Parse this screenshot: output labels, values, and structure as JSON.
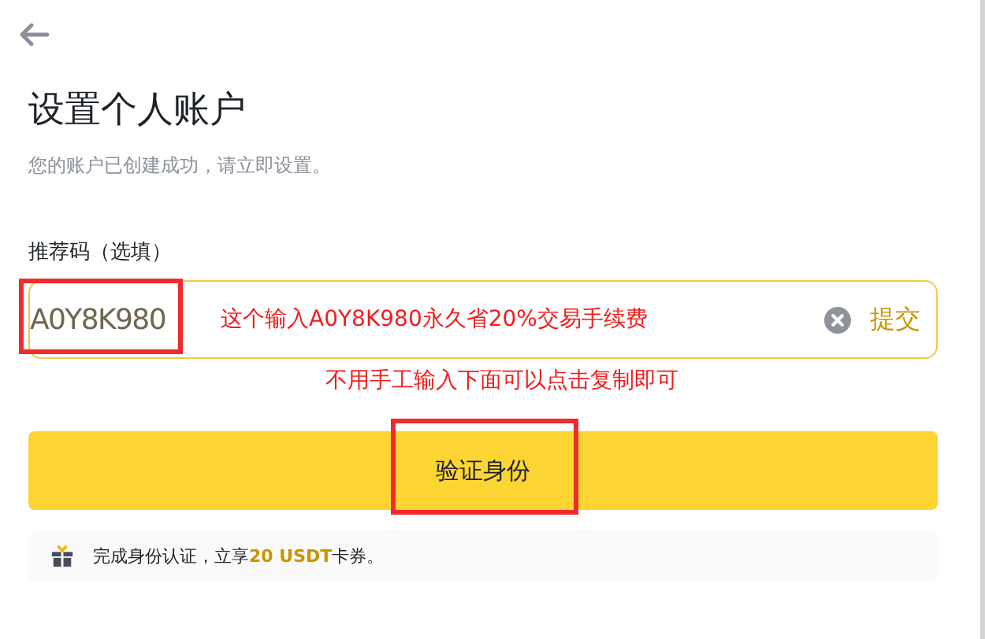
{
  "title": "设置个人账户",
  "subtitle": "您的账户已创建成功，请立即设置。",
  "referral": {
    "label": "推荐码（选填）",
    "value": "A0Y8K980",
    "submit": "提交"
  },
  "verify_button": "验证身份",
  "promo": "完成身份认证，立享**20 USDT**卡券。",
  "annotations": {
    "inline_note": "这个输入A0Y8K980永久省20%交易手续费",
    "below_note": "不用手工输入下面可以点击复制即可"
  }
}
